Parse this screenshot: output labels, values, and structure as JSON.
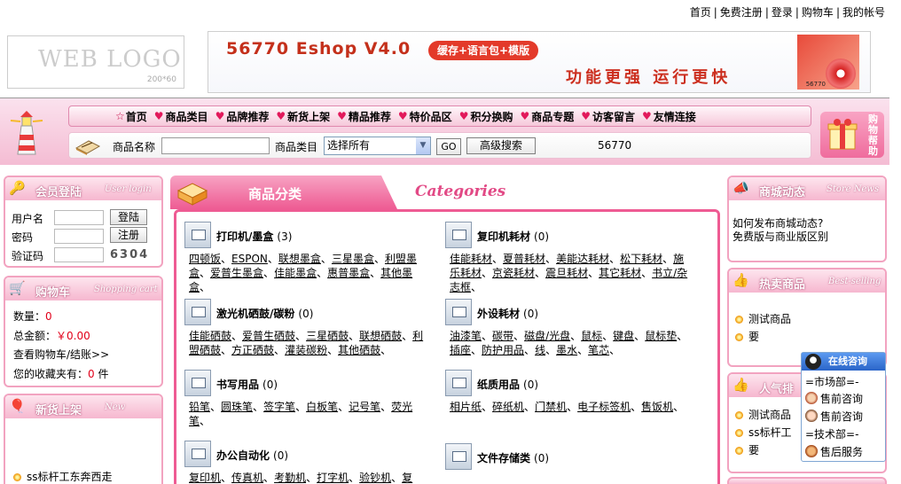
{
  "top_links": [
    "首页",
    "免费注册",
    "登录",
    "购物车",
    "我的帐号"
  ],
  "top_sep": "|",
  "logo": {
    "text": "WEB LOGO",
    "size": "200*60"
  },
  "banner": {
    "title": "56770  Eshop V4.0",
    "pill": "缓存+语言包+模版",
    "slogan": "功能更强   运行更快",
    "box_label": "56770"
  },
  "nav": [
    {
      "label": "首页",
      "icon": "star"
    },
    {
      "label": "商品类目",
      "icon": "heart"
    },
    {
      "label": "品牌推荐",
      "icon": "heart"
    },
    {
      "label": "新货上架",
      "icon": "heart"
    },
    {
      "label": "精品推荐",
      "icon": "heart"
    },
    {
      "label": "特价品区",
      "icon": "heart"
    },
    {
      "label": "积分换购",
      "icon": "heart"
    },
    {
      "label": "商品专题",
      "icon": "heart"
    },
    {
      "label": "访客留言",
      "icon": "heart"
    },
    {
      "label": "友情连接",
      "icon": "heart"
    }
  ],
  "search": {
    "name_label": "商品名称",
    "name_value": "",
    "category_label": "商品类目",
    "category_selected": "选择所有",
    "go_label": "GO",
    "advanced_label": "高级搜索",
    "number": "56770"
  },
  "help": {
    "label": "购物帮助"
  },
  "login": {
    "title": "会员登陆",
    "script": "User login",
    "username_label": "用户名",
    "password_label": "密码",
    "captcha_label": "验证码",
    "login_button": "登陆",
    "register_button": "注册",
    "captcha": "6304"
  },
  "cart": {
    "title": "购物车",
    "script": "Shopping cart",
    "qty_label": "数量：",
    "qty": "0",
    "total_label": "总金额：",
    "total": "￥0.00",
    "view_link": "查看购物车/结账>>",
    "fav_label": "您的收藏夹有：",
    "fav_count": "0",
    "fav_unit": "件"
  },
  "new_arrivals": {
    "title": "新货上架",
    "script": "New",
    "items": [
      "ss标杆工东奔西走"
    ]
  },
  "categories": {
    "title": "商品分类",
    "eng": "Categories",
    "list": [
      {
        "name": "打印机/墨盒",
        "count": "(3)",
        "items": [
          "四顿饭",
          "ESPON",
          "联想墨盒",
          "三星墨盒",
          "利盟墨盒",
          "爱普生墨盒",
          "佳能墨盒",
          "惠普墨盒",
          "其他墨盒"
        ]
      },
      {
        "name": "复印机耗材",
        "count": "(0)",
        "items": [
          "佳能耗材",
          "夏普耗材",
          "美能达耗材",
          "松下耗材",
          "施乐耗材",
          "京瓷耗材",
          "震旦耗材",
          "其它耗材",
          "书立/杂志框"
        ]
      },
      {
        "name": "激光机硒鼓/碳粉",
        "count": "(0)",
        "items": [
          "佳能硒鼓",
          "爱普生硒鼓",
          "三星硒鼓",
          "联想硒鼓",
          "利盟硒鼓",
          "方正硒鼓",
          "灌装碳粉",
          "其他硒鼓"
        ]
      },
      {
        "name": "外设耗材",
        "count": "(0)",
        "items": [
          "油漆笔",
          "碳带",
          "磁盘/光盘",
          "鼠标",
          "键盘",
          "鼠标垫",
          "插座",
          "防护用品",
          "线",
          "墨水",
          "笔芯"
        ]
      },
      {
        "name": "书写用品",
        "count": "(0)",
        "items": [
          "铅笔",
          "圆珠笔",
          "签字笔",
          "白板笔",
          "记号笔",
          "荧光笔"
        ]
      },
      {
        "name": "纸质用品",
        "count": "(0)",
        "items": [
          "相片纸",
          "碎纸机",
          "门禁机",
          "电子标签机",
          "售饭机"
        ]
      },
      {
        "name": "办公自动化",
        "count": "(0)",
        "items": [
          "复印机",
          "传真机",
          "考勤机",
          "打字机",
          "验钞机",
          "复印"
        ]
      },
      {
        "name": "文件存储类",
        "count": "(0)",
        "items": []
      }
    ]
  },
  "news": {
    "title": "商城动态",
    "script": "Store News",
    "items": [
      "如何发布商城动态?",
      "免费版与商业版区别"
    ]
  },
  "hot": {
    "title": "热卖商品",
    "script": "Best-selling",
    "items": [
      "测试商品",
      "要"
    ]
  },
  "popular": {
    "title": "人气排",
    "items": [
      "测试商品",
      "ss标杆工",
      "要"
    ]
  },
  "chat": {
    "title": "在线咨询",
    "rows": [
      "=市场部=-",
      "售前咨询",
      "售前咨询",
      "=技术部=-",
      "售后服务"
    ]
  }
}
